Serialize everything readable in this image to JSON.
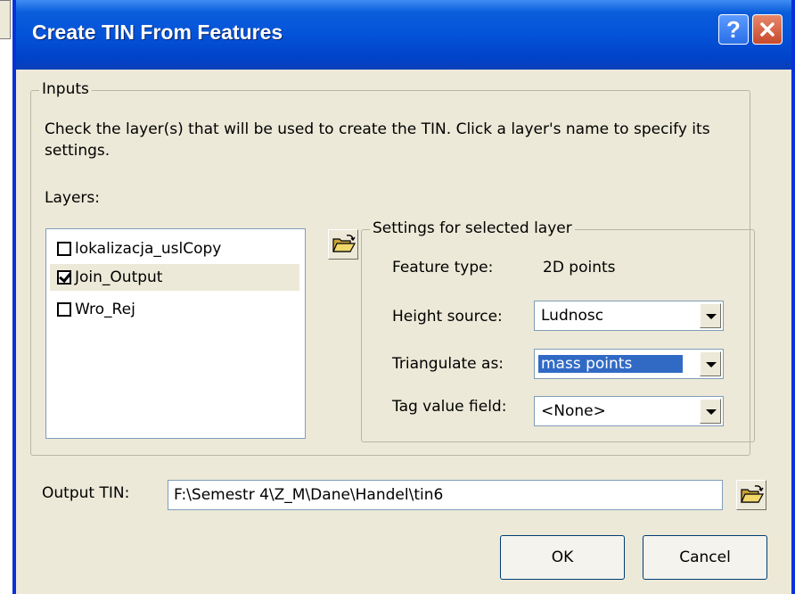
{
  "window": {
    "title": "Create TIN From Features",
    "help_label": "?",
    "close_icon": "close-icon"
  },
  "inputs": {
    "legend": "Inputs",
    "instructions": "Check the layer(s) that will be used to create the TIN.  Click a layer's name to specify its settings.",
    "layers_label": "Layers:",
    "layers": [
      {
        "name": "lokalizacja_uslCopy",
        "checked": false,
        "selected": false
      },
      {
        "name": "Join_Output",
        "checked": true,
        "selected": true
      },
      {
        "name": "Wro_Rej",
        "checked": false,
        "selected": false
      }
    ],
    "add_layer_icon": "folder-open-icon"
  },
  "settings": {
    "legend": "Settings for selected layer",
    "feature_type_label": "Feature type:",
    "feature_type_value": "2D points",
    "height_source_label": "Height source:",
    "height_source_value": "Ludnosc",
    "triangulate_label": "Triangulate as:",
    "triangulate_value": "mass points",
    "tag_field_label": "Tag value field:",
    "tag_field_value": "<None>"
  },
  "output": {
    "label": "Output TIN:",
    "value": "F:\\Semestr 4\\Z_M\\Dane\\Handel\\tin6",
    "browse_icon": "folder-open-icon"
  },
  "buttons": {
    "ok": "OK",
    "cancel": "Cancel"
  },
  "colors": {
    "titlebar": "#0453d8",
    "dialog_bg": "#ece9d8",
    "selection": "#316ac5",
    "close_button": "#c74a2c"
  }
}
